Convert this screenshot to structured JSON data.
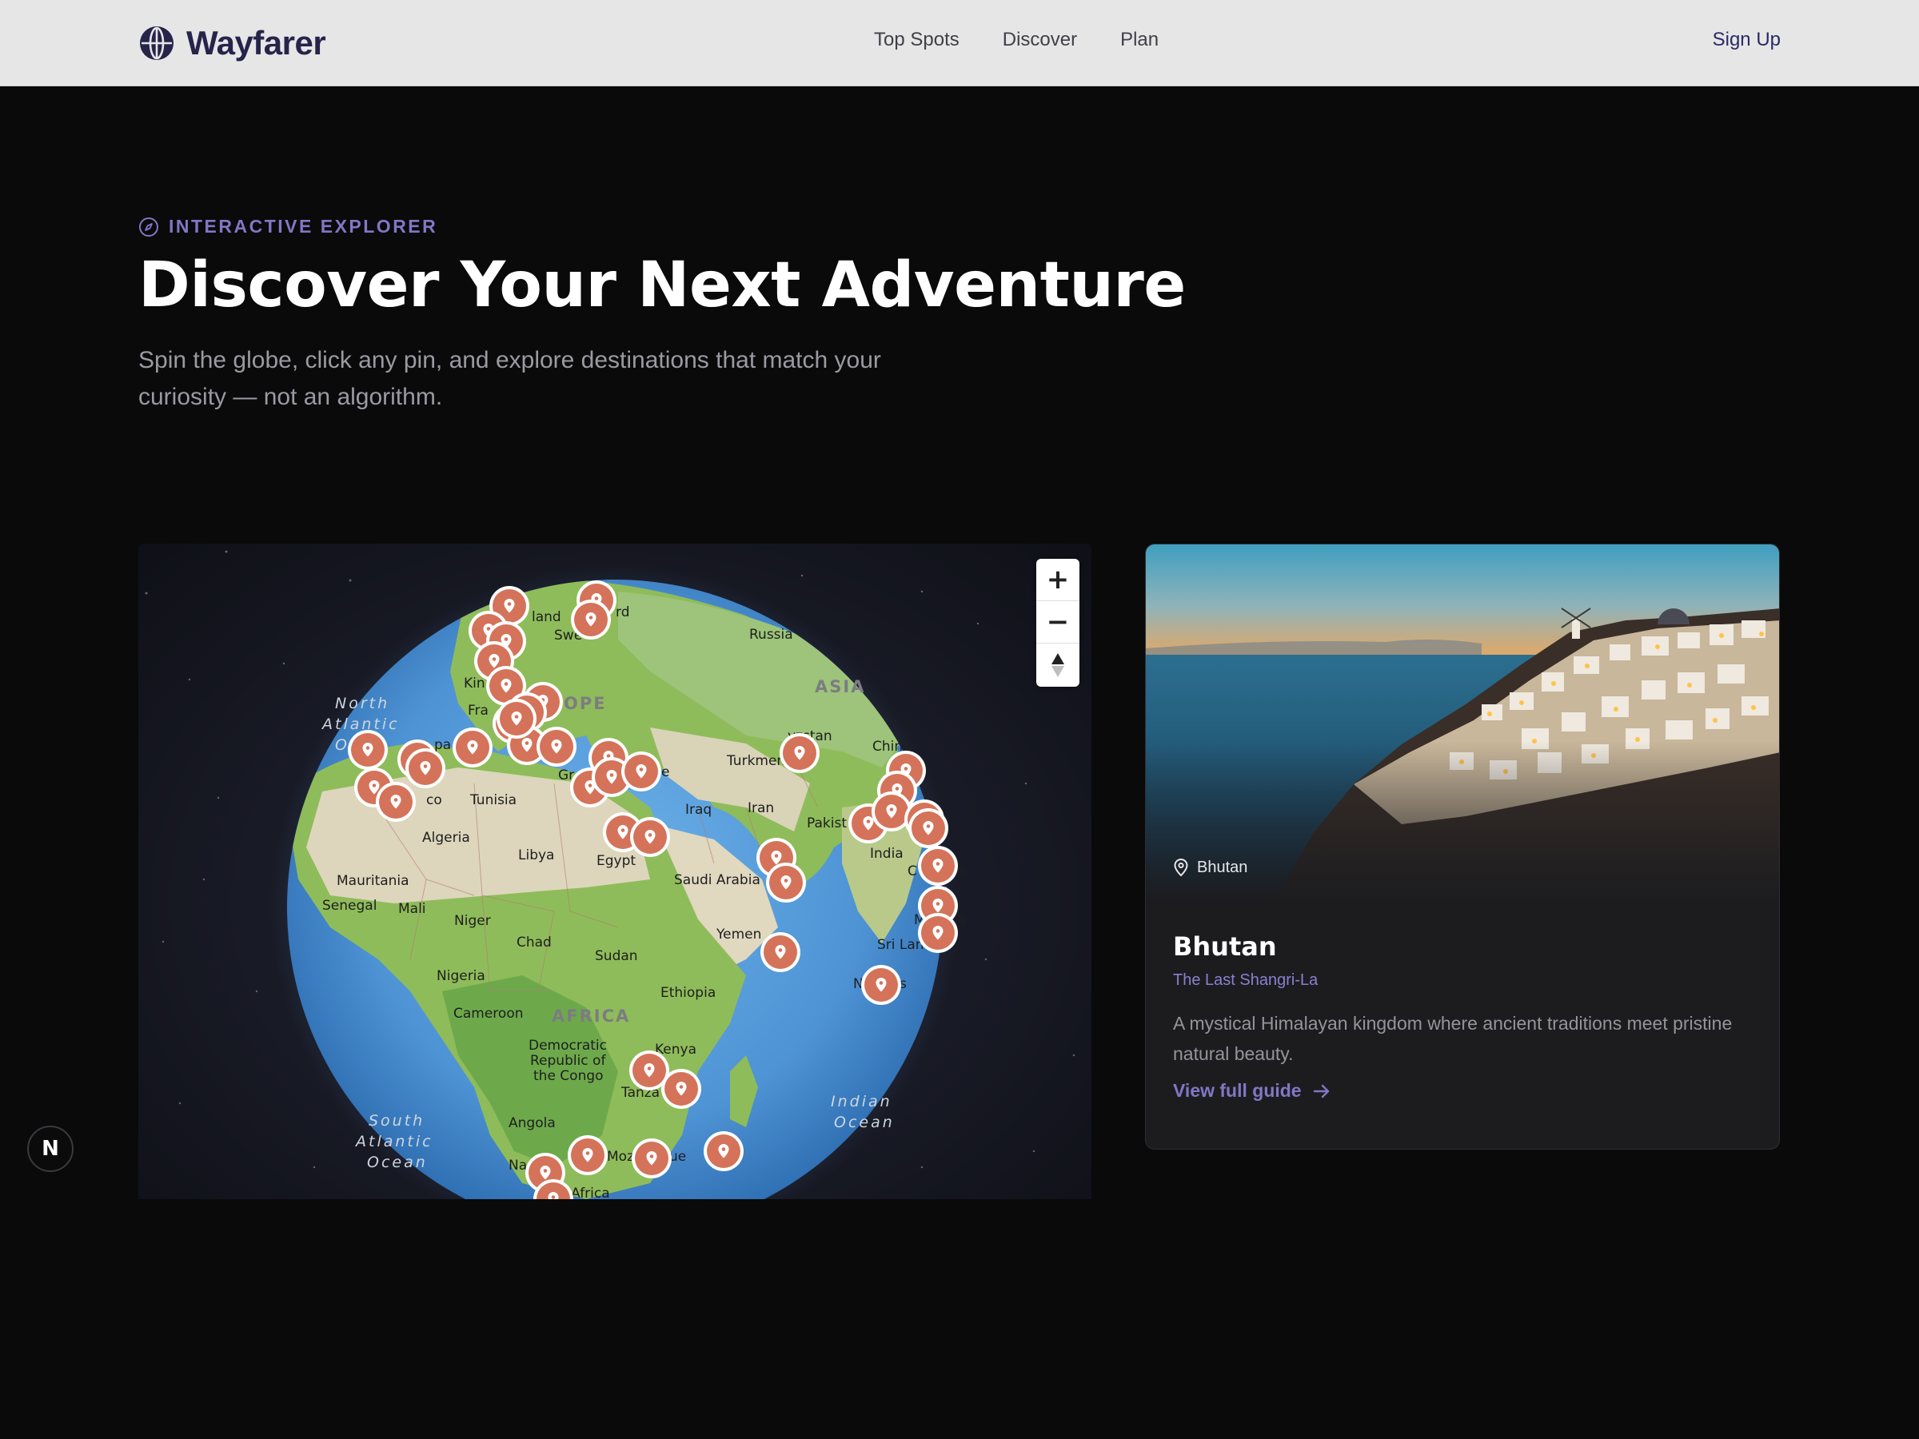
{
  "brand": {
    "name": "Wayfarer",
    "icon": "globe-icon"
  },
  "nav": {
    "items": [
      "Top Spots",
      "Discover",
      "Plan"
    ]
  },
  "header": {
    "signup_label": "Sign Up"
  },
  "hero": {
    "eyebrow": "INTERACTIVE EXPLORER",
    "eyebrow_icon": "compass-icon",
    "title": "Discover Your Next Adventure",
    "subtitle": "Spin the globe, click any pin, and explore destinations that match your curiosity — not an algorithm."
  },
  "map": {
    "labels": {
      "land": "land",
      "rd": "rd",
      "russia": "Russia",
      "swe": "Swe",
      "asia": "ASIA",
      "kin": "Kin",
      "europe": "OPE",
      "fra": "Fra",
      "kyrgyzstan": "yzstan",
      "china": "China",
      "pa": "pa",
      "turkmen": "Turkmen",
      "tunisia": "Tunisia",
      "co": "co",
      "gr": "Gr",
      "e": "e",
      "iraq": "Iraq",
      "iran": "Iran",
      "pakist": "Pakist",
      "algeria": "Algeria",
      "libya": "Libya",
      "egypt": "Egypt",
      "india": "India",
      "saudi": "Saudi Arabia",
      "mauritania": "Mauritania",
      "senegal": "Senegal",
      "mali": "Mali",
      "niger": "Niger",
      "chad": "Chad",
      "yemen": "Yemen",
      "srilan": "Sri Lan",
      "sudan": "Sudan",
      "nigeria": "Nigeria",
      "ethiopia": "Ethiopia",
      "cameroon": "Cameroon",
      "africa": "AFRICA",
      "drc1": "Democratic",
      "drc2": "Republic of",
      "drc3": "the Congo",
      "kenya": "Kenya",
      "tanza": "Tanza",
      "angola": "Angola",
      "na": "Na",
      "moz": "Moz",
      "ue": "ue",
      "safrica": "h Africa",
      "c": "C",
      "a1": "a",
      "m": "M",
      "a2": "a",
      "n": "N",
      "s": "s",
      "h": "h"
    },
    "oceans": {
      "north_atlantic": [
        "North",
        "Atlantic",
        "O"
      ],
      "south_atlantic": [
        "South",
        "Atlantic",
        "Ocean"
      ],
      "indian": [
        "Indian",
        "Ocean"
      ]
    },
    "zoom": {
      "in_label": "+",
      "out_label": "−",
      "compass_label": "▲"
    },
    "pin_icon": "map-pin-icon"
  },
  "dev_badge": {
    "label": "N"
  },
  "card": {
    "location": "Bhutan",
    "location_icon": "map-pin-icon",
    "title": "Bhutan",
    "tagline": "The Last Shangri-La",
    "description": "A mystical Himalayan kingdom where ancient traditions meet pristine natural beauty.",
    "link_label": "View full guide",
    "link_icon": "arrow-right-icon"
  }
}
